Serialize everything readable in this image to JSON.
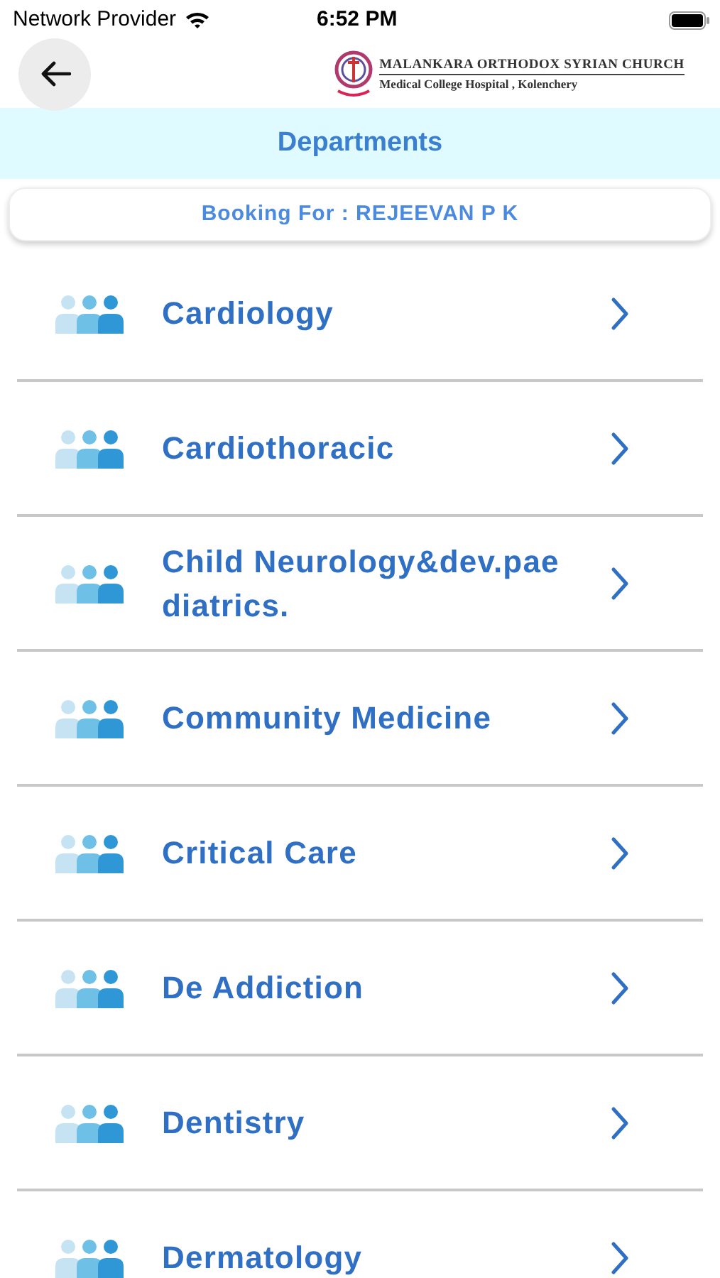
{
  "status_bar": {
    "carrier": "Network Provider",
    "time": "6:52 PM"
  },
  "header": {
    "logo_line_1": "MALANKARA ORTHODOX SYRIAN CHURCH",
    "logo_line_2": "Medical College Hospital , Kolenchery"
  },
  "title": "Departments",
  "booking_for": "Booking For : REJEEVAN P K",
  "departments": [
    {
      "name": "Cardiology"
    },
    {
      "name": "Cardiothoracic"
    },
    {
      "name": "Child Neurology&dev.paediatrics."
    },
    {
      "name": "Community Medicine"
    },
    {
      "name": "Critical Care"
    },
    {
      "name": "De Addiction"
    },
    {
      "name": "Dentistry"
    },
    {
      "name": "Dermatology"
    }
  ]
}
